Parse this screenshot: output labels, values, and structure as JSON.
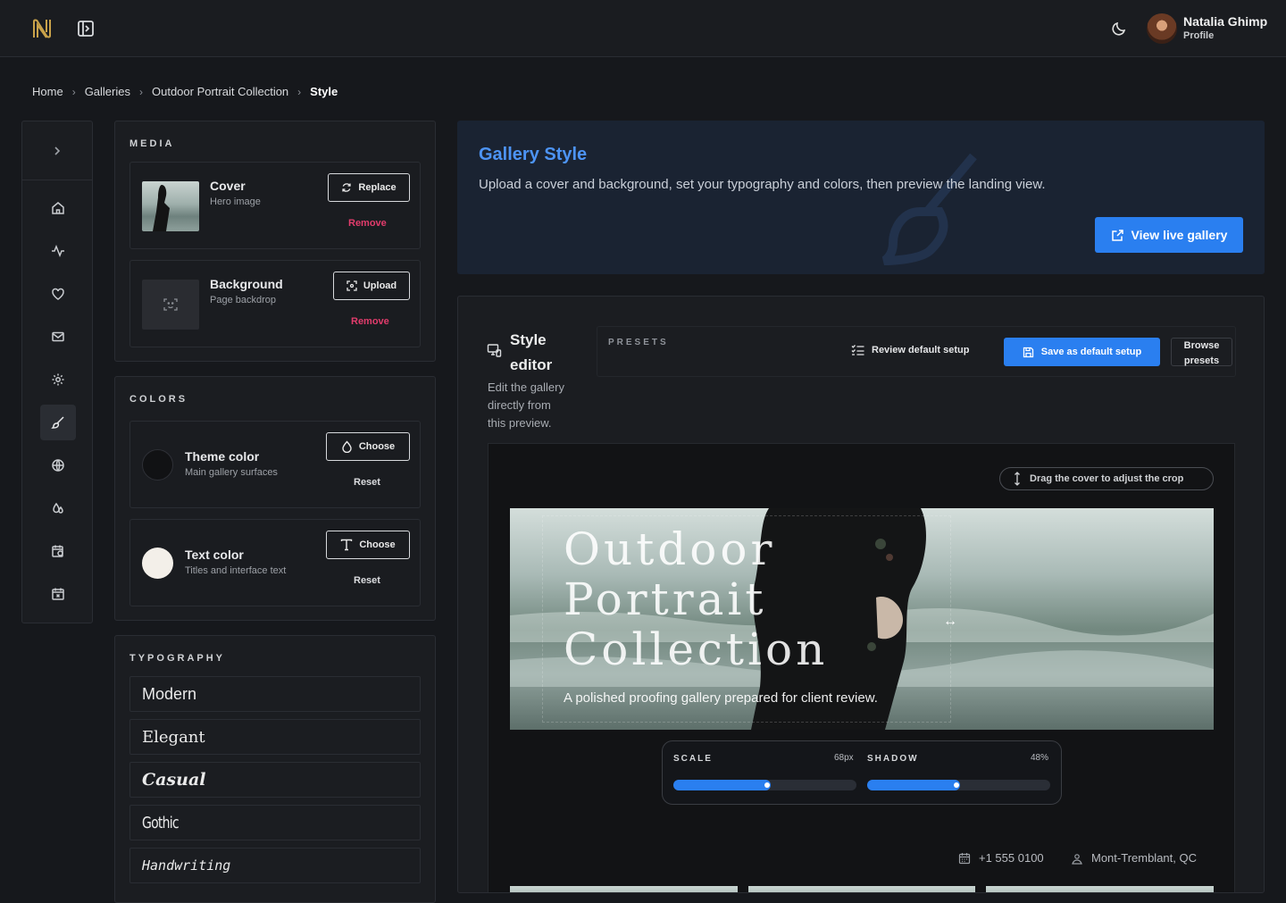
{
  "user": {
    "name": "Natalia Ghimp",
    "role": "Profile"
  },
  "breadcrumb": [
    "Home",
    "Galleries",
    "Outdoor Portrait Collection",
    "Style"
  ],
  "media": {
    "heading": "MEDIA",
    "cover": {
      "title": "Cover",
      "subtitle": "Hero image",
      "action": "Replace",
      "remove": "Remove"
    },
    "background": {
      "title": "Background",
      "subtitle": "Page backdrop",
      "action": "Upload",
      "remove": "Remove"
    }
  },
  "colors": {
    "heading": "COLORS",
    "theme": {
      "title": "Theme color",
      "subtitle": "Main gallery surfaces",
      "action": "Choose",
      "reset": "Reset",
      "value": "#111214"
    },
    "text": {
      "title": "Text color",
      "subtitle": "Titles and interface text",
      "action": "Choose",
      "reset": "Reset",
      "value": "#f3efe9"
    }
  },
  "typography": {
    "heading": "TYPOGRAPHY",
    "fonts": [
      "Modern",
      "Elegant",
      "Casual",
      "Gothic",
      "Handwriting"
    ]
  },
  "hero": {
    "title": "Gallery Style",
    "description": "Upload a cover and background, set your typography and colors, then preview the landing view.",
    "cta": "View live gallery"
  },
  "editor": {
    "title_line1": "Style",
    "title_line2": "editor",
    "desc_line1": "Edit the gallery",
    "desc_line2": "directly from",
    "desc_line3": "this preview.",
    "presets_label": "PRESETS",
    "review": "Review default setup",
    "save": "Save as default setup",
    "browse_line1": "Browse",
    "browse_line2": "presets"
  },
  "preview": {
    "hint": "Drag the cover to adjust the crop",
    "cover_title_line1": "Outdoor",
    "cover_title_line2": "Portrait",
    "cover_title_line3": "Collection",
    "cover_subtitle": "A polished proofing gallery prepared for client review.",
    "scale_label": "SCALE",
    "scale_value": "68px",
    "scale_fraction": 0.5,
    "shadow_label": "SHADOW",
    "shadow_value": "48%",
    "shadow_fraction": 0.48,
    "phone": "+1 555 0100",
    "location": "Mont-Tremblant, QC"
  },
  "theme_colors": {
    "accent": "#2a7ff0",
    "danger": "#e23c6c",
    "background": "#16181c"
  }
}
